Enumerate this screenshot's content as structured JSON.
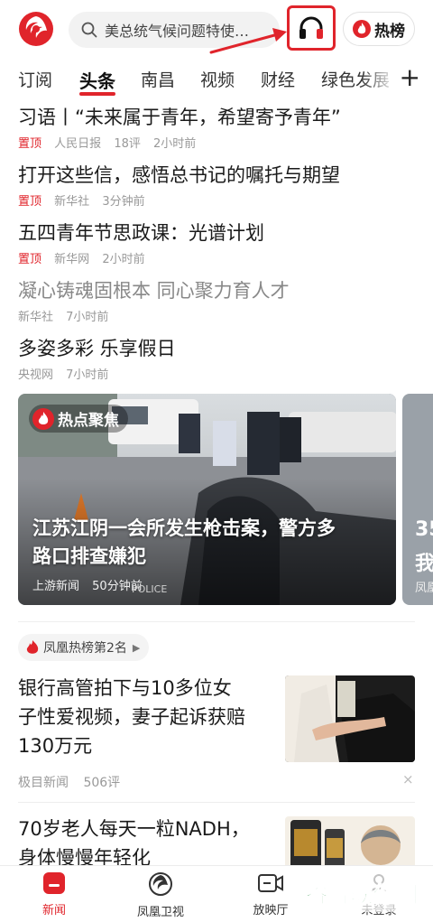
{
  "header": {
    "search_placeholder": "美总统气候问题特使…",
    "hot_button_label": "热榜"
  },
  "tabs": [
    "订阅",
    "头条",
    "南昌",
    "视频",
    "财经",
    "绿色发展"
  ],
  "tabs_plus": "+",
  "news": [
    {
      "title": "习语丨“未来属于青年，希望寄予青年”",
      "pin": "置顶",
      "source": "人民日报",
      "comments": "18评",
      "time": "2小时前"
    },
    {
      "title": "打开这些信，感悟总书记的嘱托与期望",
      "pin": "置顶",
      "source": "新华社",
      "comments": "",
      "time": "3分钟前"
    },
    {
      "title": "五四青年节思政课：光谱计划",
      "pin": "置顶",
      "source": "新华网",
      "comments": "",
      "time": "2小时前"
    },
    {
      "title": "凝心铸魂固根本 同心聚力育人才",
      "pin": "",
      "source": "新华社",
      "comments": "",
      "time": "7小时前"
    },
    {
      "title": "多姿多彩 乐享假日",
      "pin": "",
      "source": "央视网",
      "comments": "",
      "time": "7小时前"
    }
  ],
  "hot_card": {
    "badge": "热点聚焦",
    "title_line1": "江苏江阴一会所发生枪击案，警方多",
    "title_line2": "路口排查嫌犯",
    "source": "上游新闻",
    "time": "50分钟前",
    "scene_text": "POLICE",
    "next_line1": "35",
    "next_line2": "我",
    "next_source": "凤凰"
  },
  "ranking_label": "凤凰热榜第2名",
  "articles": [
    {
      "line1": "银行高管拍下与10多位女",
      "line2": "子性爱视频，妻子起诉获赔",
      "line3": "130万元",
      "source": "极目新闻",
      "comments": "506评",
      "close": "×"
    },
    {
      "line1": "70岁老人每天一粒NADH，",
      "line2": "身体慢慢年轻化"
    }
  ],
  "bottom_nav": [
    {
      "label": "新闻",
      "icon": "news-icon",
      "active": true
    },
    {
      "label": "凤凰卫视",
      "icon": "phoenix-tv-icon",
      "active": false
    },
    {
      "label": "放映厅",
      "icon": "video-camera-icon",
      "active": false
    },
    {
      "label": "未登录",
      "icon": "profile-icon",
      "active": false
    }
  ],
  "watermark": "谷普软件园",
  "colors": {
    "accent": "#e0242b",
    "watermark": "#1e8a3a"
  }
}
